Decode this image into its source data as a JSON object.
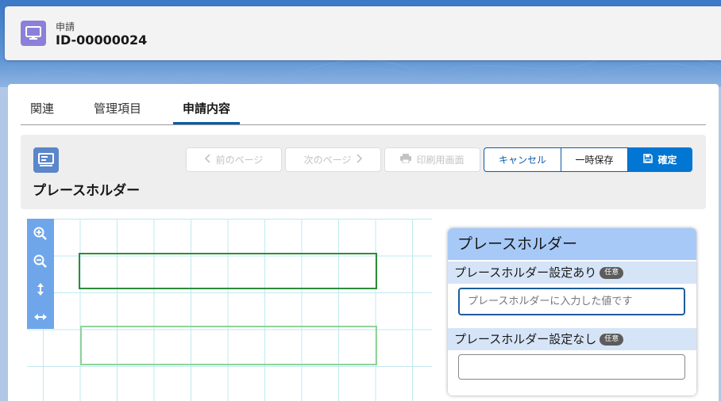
{
  "header": {
    "object_type": "申請",
    "record_name": "ID-00000024"
  },
  "tabs": [
    {
      "label": "関連"
    },
    {
      "label": "管理項目"
    },
    {
      "label": "申請内容"
    }
  ],
  "panel": {
    "title": "プレースホルダー"
  },
  "toolbar": {
    "prev_label": "前のページ",
    "next_label": "次のページ",
    "print_label": "印刷用画面",
    "cancel_label": "キャンセル",
    "temp_save_label": "一時保存",
    "confirm_label": "確定"
  },
  "preview": {
    "title": "プレースホルダー",
    "field1": {
      "label": "プレースホルダー設定あり",
      "badge": "任意",
      "placeholder": "プレースホルダーに入力した値です"
    },
    "field2": {
      "label": "プレースホルダー設定なし",
      "badge": "任意",
      "placeholder": ""
    }
  },
  "colors": {
    "brand_blue": "#0176d3",
    "record_icon": "#8b80d9",
    "preview_header": "#a7c9f7"
  }
}
